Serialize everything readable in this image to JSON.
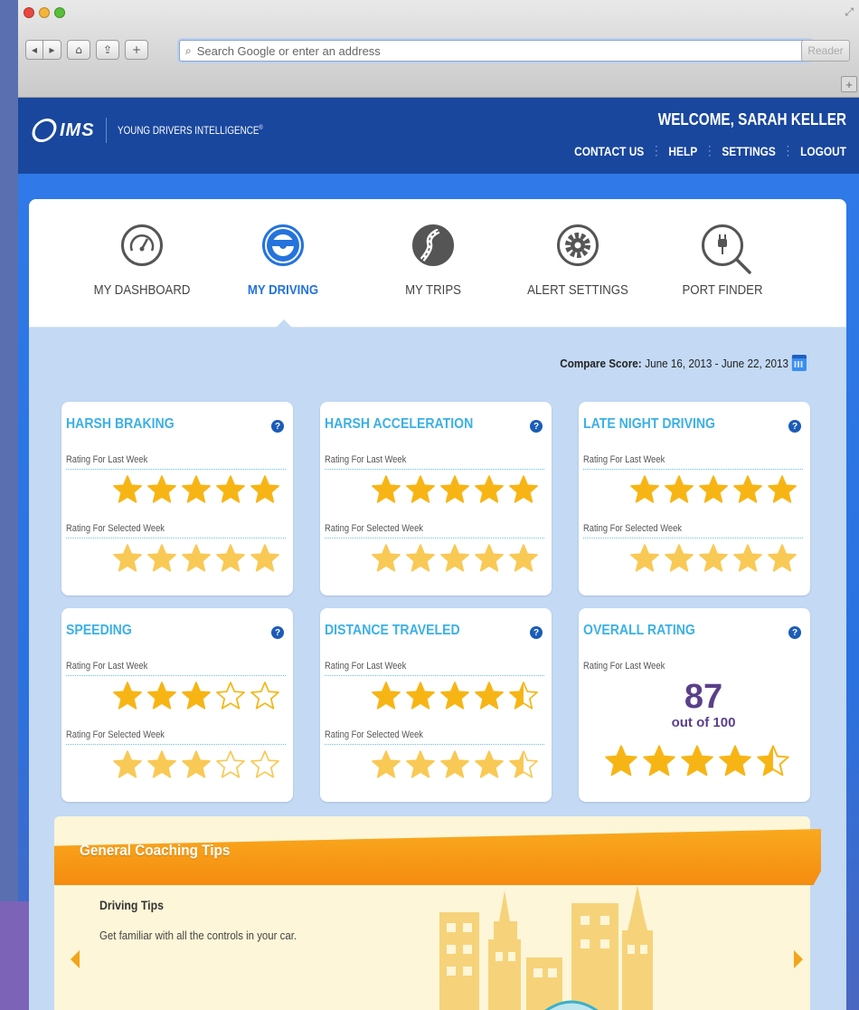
{
  "browser": {
    "search_placeholder": "Search Google or enter an address",
    "reader_label": "Reader",
    "new_tab_label": "+"
  },
  "header": {
    "logo_text": "IMS",
    "product_name": "YOUNG DRIVERS INTELLIGENCE",
    "trademark": "®",
    "welcome": "WELCOME, SARAH KELLER",
    "links": [
      "CONTACT US",
      "HELP",
      "SETTINGS",
      "LOGOUT"
    ]
  },
  "tabs": [
    {
      "label": "MY DASHBOARD",
      "icon": "speedometer-icon",
      "active": false
    },
    {
      "label": "MY DRIVING",
      "icon": "steering-wheel-icon",
      "active": true
    },
    {
      "label": "MY TRIPS",
      "icon": "road-icon",
      "active": false
    },
    {
      "label": "ALERT SETTINGS",
      "icon": "gear-icon",
      "active": false
    },
    {
      "label": "PORT FINDER",
      "icon": "plug-search-icon",
      "active": false
    }
  ],
  "compare": {
    "label": "Compare Score:",
    "range": "June 16, 2013 - June 22, 2013"
  },
  "ratings": {
    "last_week_label": "Rating For Last Week",
    "selected_week_label": "Rating For Selected Week",
    "tiles": [
      {
        "title": "HARSH BRAKING",
        "last_week_stars": 5,
        "selected_week_stars": 5
      },
      {
        "title": "HARSH ACCELERATION",
        "last_week_stars": 5,
        "selected_week_stars": 5
      },
      {
        "title": "LATE NIGHT DRIVING",
        "last_week_stars": 5,
        "selected_week_stars": 5
      },
      {
        "title": "SPEEDING",
        "last_week_stars": 3,
        "selected_week_stars": 3
      },
      {
        "title": "DISTANCE TRAVELED",
        "last_week_stars": 4.5,
        "selected_week_stars": 4.5
      }
    ],
    "overall": {
      "title": "OVERALL RATING",
      "score": "87",
      "out_of": "out of 100",
      "stars": 4.5
    },
    "help_glyph": "?"
  },
  "tips": {
    "banner_title": "General Coaching Tips",
    "heading": "Driving Tips",
    "text": "Get familiar with all the controls in your car."
  },
  "colors": {
    "header_blue": "#19479e",
    "accent_blue": "#2573dc",
    "title_cyan": "#3cb0e6",
    "star_gold": "#f7b515",
    "score_purple": "#5a3f8a",
    "banner_orange": "#f58c10"
  }
}
